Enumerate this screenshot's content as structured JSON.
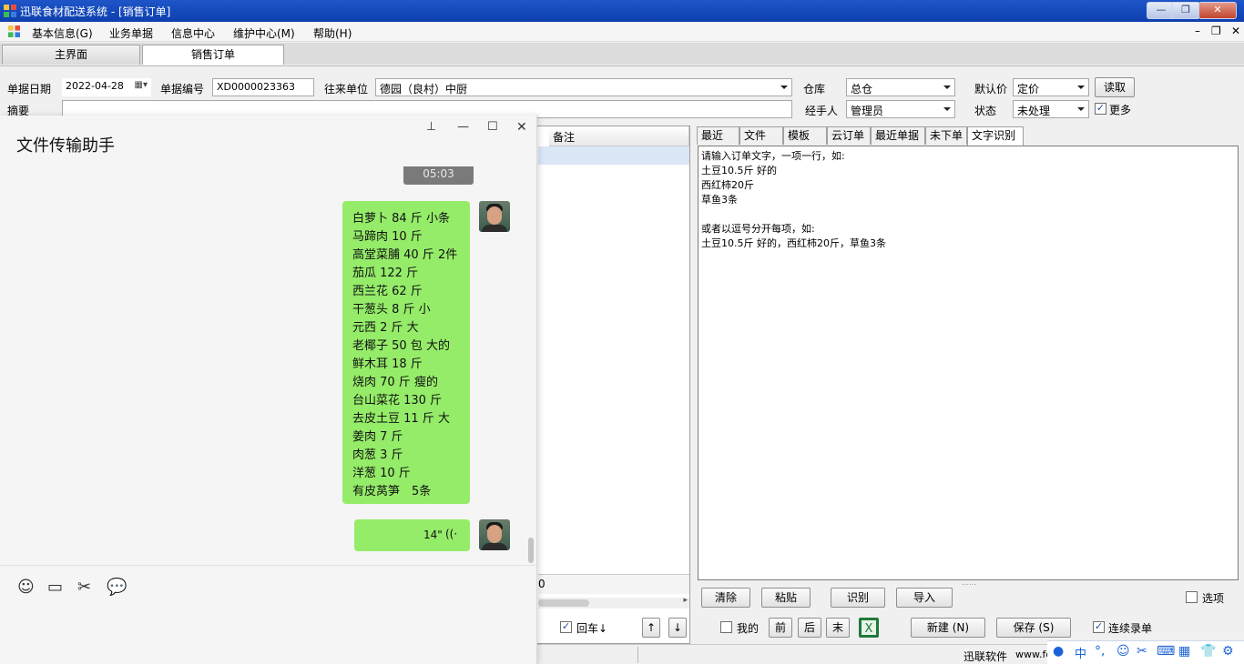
{
  "window": {
    "title": "迅联食材配送系统 - [销售订单]",
    "min_label": "—",
    "max_label": "❐",
    "close_label": "✕"
  },
  "menu": {
    "items": [
      "基本信息(G)",
      "业务单据",
      "信息中心",
      "维护中心(M)",
      "帮助(H)"
    ],
    "mdi_min": "–",
    "mdi_restore": "❐",
    "mdi_close": "✕"
  },
  "tabs": [
    "主界面",
    "销售订单"
  ],
  "form": {
    "date_label": "单据日期",
    "date_value": "2022-04-28",
    "number_label": "单据编号",
    "number_value": "XD0000023363",
    "partner_label": "往来单位",
    "partner_value": "德园（良村）中厨",
    "warehouse_label": "仓库",
    "warehouse_value": "总仓",
    "price_label": "默认价",
    "price_value": "定价",
    "read_button": "读取",
    "memo_label": "摘要",
    "handler_label": "经手人",
    "handler_value": "管理员",
    "status_label": "状态",
    "status_value": "未处理",
    "more_label": "更多"
  },
  "table": {
    "remark_header": "备注",
    "footer_value": "0"
  },
  "right_tabs": [
    "最近",
    "文件",
    "模板",
    "云订单",
    "最近单据",
    "未下单",
    "文字识别"
  ],
  "ocr": {
    "text": "请输入订单文字，一项一行，如:\n土豆10.5斤 好的\n西红柿20斤\n草鱼3条\n\n或者以逗号分开每项，如:\n土豆10.5斤 好的，西红柿20斤，草鱼3条",
    "clear_button": "清除",
    "paste_button": "粘贴",
    "recognize_button": "识别",
    "import_button": "导入",
    "options_label": "选项"
  },
  "bottom": {
    "enter_label": "回车↓",
    "up_button": "↑",
    "down_button": "↓",
    "mine_label": "我的",
    "prev_button": "前",
    "next_button": "后",
    "last_button": "末",
    "new_button": "新建 (N)",
    "save_button": "保存 (S)",
    "continuous_label": "连续录单",
    "status_company": "迅联软件",
    "status_url": "www.fo"
  },
  "chat": {
    "title": "文件传输助手",
    "prev_time": "05:03",
    "message_lines": [
      "白萝卜 84 斤 小条",
      "马蹄肉 10 斤",
      "高堂菜脯 40 斤 2件",
      "茄瓜 122 斤",
      "西兰花 62 斤",
      "干葱头 8 斤 小",
      "元西 2 斤 大",
      "老椰子 50 包 大的",
      "鲜木耳 18 斤",
      "烧肉 70 斤 瘦的",
      "台山菜花 130 斤",
      "去皮土豆 11 斤 大",
      "姜肉 7 斤",
      "肉葱 3 斤",
      "洋葱 10 斤",
      "有皮莴笋　5条"
    ],
    "voice_duration": "14\"",
    "voice_icon": "((·"
  },
  "taskbar": {
    "ime_label": "中"
  }
}
